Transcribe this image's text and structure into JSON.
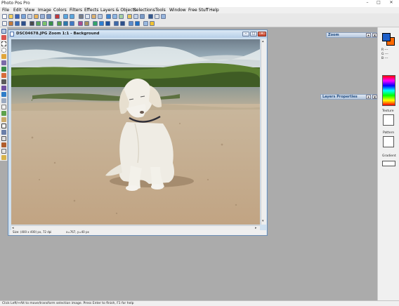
{
  "app": {
    "title": "Photo Pos Pro"
  },
  "window_controls": {
    "minimize": "–",
    "maximize": "□",
    "close": "✕"
  },
  "menu": [
    "File",
    "Edit",
    "View",
    "Image",
    "Colors",
    "Filters",
    "Effects",
    "Layers & Objects",
    "Selections",
    "Tools",
    "Window",
    "Free Stuff",
    "Help"
  ],
  "document": {
    "title": "DSC04678.JPG  Zoom 1:1 - Background",
    "size_info": "Size: (400 x 400) px, 72 dpi",
    "position_info": "x=767, y=40 px",
    "controls": {
      "minimize": "–",
      "maximize": "□",
      "close": "✕"
    }
  },
  "panels": {
    "zoom": {
      "title": "Zoom",
      "pin": "⌖",
      "close": "x"
    },
    "layers": {
      "title": "Layers Properties",
      "pin": "⌖",
      "close": "x"
    }
  },
  "right_panel": {
    "rgb": [
      "R ---",
      "G ---",
      "B ---"
    ],
    "texture_label": "Texture",
    "pattern_label": "Pattern",
    "gradient_label": "Gradient"
  },
  "status": {
    "text": "Click Left/+Alt to move/transform selection image. Press Enter to finish, F1 for help"
  },
  "colors": {
    "foreground": "#1e5fc9",
    "background": "#ff6a00",
    "title_bar": "#ffffff",
    "dock_bg": "#ababab"
  }
}
